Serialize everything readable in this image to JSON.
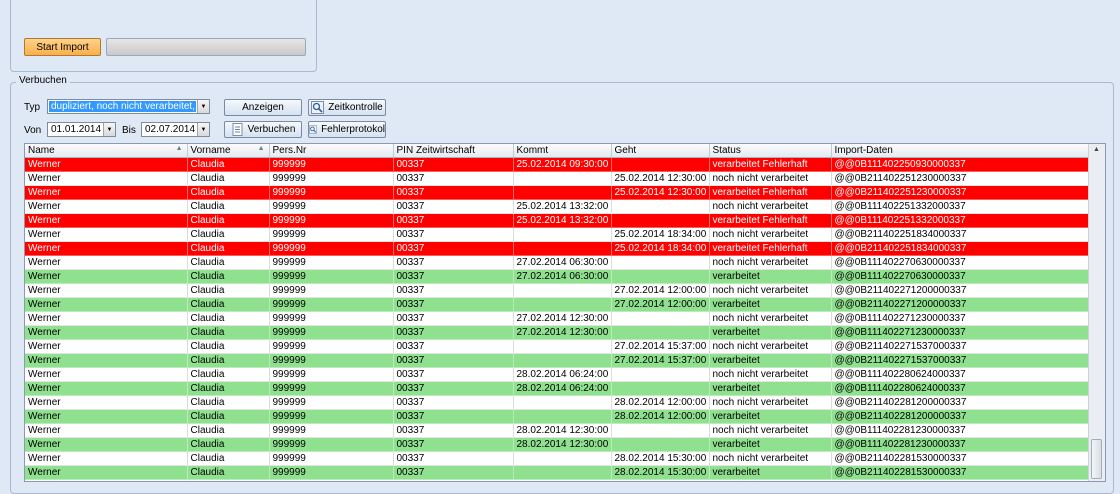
{
  "import": {
    "start_label": "Start Import",
    "progress": 0
  },
  "verbuchen": {
    "legend": "Verbuchen",
    "typ_label": "Typ",
    "typ_value": "dupliziert, noch nicht verarbeitet, verar",
    "von_label": "Von",
    "von_value": "01.01.2014",
    "bis_label": "Bis",
    "bis_value": "02.07.2014",
    "anzeigen_label": "Anzeigen",
    "zeitkontrolle_label": "Zeitkontrolle",
    "verbuchen_label": "Verbuchen",
    "fehlerprotokol_label": "Fehlerprotokol"
  },
  "colors": {
    "error": "#ff0000",
    "ok": "#8fe08f",
    "window": "#dfe9f5"
  },
  "icons": {
    "dropdown": "chevron-down-icon",
    "zeitkontrolle": "magnifier-icon",
    "verbuchen": "document-icon",
    "fehlerprotokol": "magnifier-icon"
  },
  "grid": {
    "columns": [
      "Name",
      "Vorname",
      "Pers.Nr",
      "PIN Zeitwirtschaft",
      "Kommt",
      "Geht",
      "Status",
      "Import-Daten"
    ],
    "rows": [
      {
        "state": "red",
        "cells": [
          "Werner",
          "Claudia",
          "999999",
          "00337",
          "25.02.2014 09:30:00",
          "",
          "verarbeitet Fehlerhaft",
          "@@0B111402250930000337"
        ]
      },
      {
        "state": "white",
        "cells": [
          "Werner",
          "Claudia",
          "999999",
          "00337",
          "",
          "25.02.2014 12:30:00",
          "noch nicht verarbeitet",
          "@@0B211402251230000337"
        ]
      },
      {
        "state": "red",
        "cells": [
          "Werner",
          "Claudia",
          "999999",
          "00337",
          "",
          "25.02.2014 12:30:00",
          "verarbeitet Fehlerhaft",
          "@@0B211402251230000337"
        ]
      },
      {
        "state": "white",
        "cells": [
          "Werner",
          "Claudia",
          "999999",
          "00337",
          "25.02.2014 13:32:00",
          "",
          "noch nicht verarbeitet",
          "@@0B111402251332000337"
        ]
      },
      {
        "state": "red",
        "cells": [
          "Werner",
          "Claudia",
          "999999",
          "00337",
          "25.02.2014 13:32:00",
          "",
          "verarbeitet Fehlerhaft",
          "@@0B111402251332000337"
        ]
      },
      {
        "state": "white",
        "cells": [
          "Werner",
          "Claudia",
          "999999",
          "00337",
          "",
          "25.02.2014 18:34:00",
          "noch nicht verarbeitet",
          "@@0B211402251834000337"
        ]
      },
      {
        "state": "red",
        "cells": [
          "Werner",
          "Claudia",
          "999999",
          "00337",
          "",
          "25.02.2014 18:34:00",
          "verarbeitet Fehlerhaft",
          "@@0B211402251834000337"
        ]
      },
      {
        "state": "white",
        "cells": [
          "Werner",
          "Claudia",
          "999999",
          "00337",
          "27.02.2014 06:30:00",
          "",
          "noch nicht verarbeitet",
          "@@0B111402270630000337"
        ]
      },
      {
        "state": "green",
        "cells": [
          "Werner",
          "Claudia",
          "999999",
          "00337",
          "27.02.2014 06:30:00",
          "",
          "verarbeitet",
          "@@0B111402270630000337"
        ]
      },
      {
        "state": "white",
        "cells": [
          "Werner",
          "Claudia",
          "999999",
          "00337",
          "",
          "27.02.2014 12:00:00",
          "noch nicht verarbeitet",
          "@@0B211402271200000337"
        ]
      },
      {
        "state": "green",
        "cells": [
          "Werner",
          "Claudia",
          "999999",
          "00337",
          "",
          "27.02.2014 12:00:00",
          "verarbeitet",
          "@@0B211402271200000337"
        ]
      },
      {
        "state": "white",
        "cells": [
          "Werner",
          "Claudia",
          "999999",
          "00337",
          "27.02.2014 12:30:00",
          "",
          "noch nicht verarbeitet",
          "@@0B111402271230000337"
        ]
      },
      {
        "state": "green",
        "cells": [
          "Werner",
          "Claudia",
          "999999",
          "00337",
          "27.02.2014 12:30:00",
          "",
          "verarbeitet",
          "@@0B111402271230000337"
        ]
      },
      {
        "state": "white",
        "cells": [
          "Werner",
          "Claudia",
          "999999",
          "00337",
          "",
          "27.02.2014 15:37:00",
          "noch nicht verarbeitet",
          "@@0B211402271537000337"
        ]
      },
      {
        "state": "green",
        "cells": [
          "Werner",
          "Claudia",
          "999999",
          "00337",
          "",
          "27.02.2014 15:37:00",
          "verarbeitet",
          "@@0B211402271537000337"
        ]
      },
      {
        "state": "white",
        "cells": [
          "Werner",
          "Claudia",
          "999999",
          "00337",
          "28.02.2014 06:24:00",
          "",
          "noch nicht verarbeitet",
          "@@0B111402280624000337"
        ]
      },
      {
        "state": "green",
        "cells": [
          "Werner",
          "Claudia",
          "999999",
          "00337",
          "28.02.2014 06:24:00",
          "",
          "verarbeitet",
          "@@0B111402280624000337"
        ]
      },
      {
        "state": "white",
        "cells": [
          "Werner",
          "Claudia",
          "999999",
          "00337",
          "",
          "28.02.2014 12:00:00",
          "noch nicht verarbeitet",
          "@@0B211402281200000337"
        ]
      },
      {
        "state": "green",
        "cells": [
          "Werner",
          "Claudia",
          "999999",
          "00337",
          "",
          "28.02.2014 12:00:00",
          "verarbeitet",
          "@@0B211402281200000337"
        ]
      },
      {
        "state": "white",
        "cells": [
          "Werner",
          "Claudia",
          "999999",
          "00337",
          "28.02.2014 12:30:00",
          "",
          "noch nicht verarbeitet",
          "@@0B111402281230000337"
        ]
      },
      {
        "state": "green",
        "cells": [
          "Werner",
          "Claudia",
          "999999",
          "00337",
          "28.02.2014 12:30:00",
          "",
          "verarbeitet",
          "@@0B111402281230000337"
        ]
      },
      {
        "state": "white",
        "cells": [
          "Werner",
          "Claudia",
          "999999",
          "00337",
          "",
          "28.02.2014 15:30:00",
          "noch nicht verarbeitet",
          "@@0B211402281530000337"
        ]
      },
      {
        "state": "green",
        "cells": [
          "Werner",
          "Claudia",
          "999999",
          "00337",
          "",
          "28.02.2014 15:30:00",
          "verarbeitet",
          "@@0B211402281530000337"
        ]
      }
    ]
  }
}
